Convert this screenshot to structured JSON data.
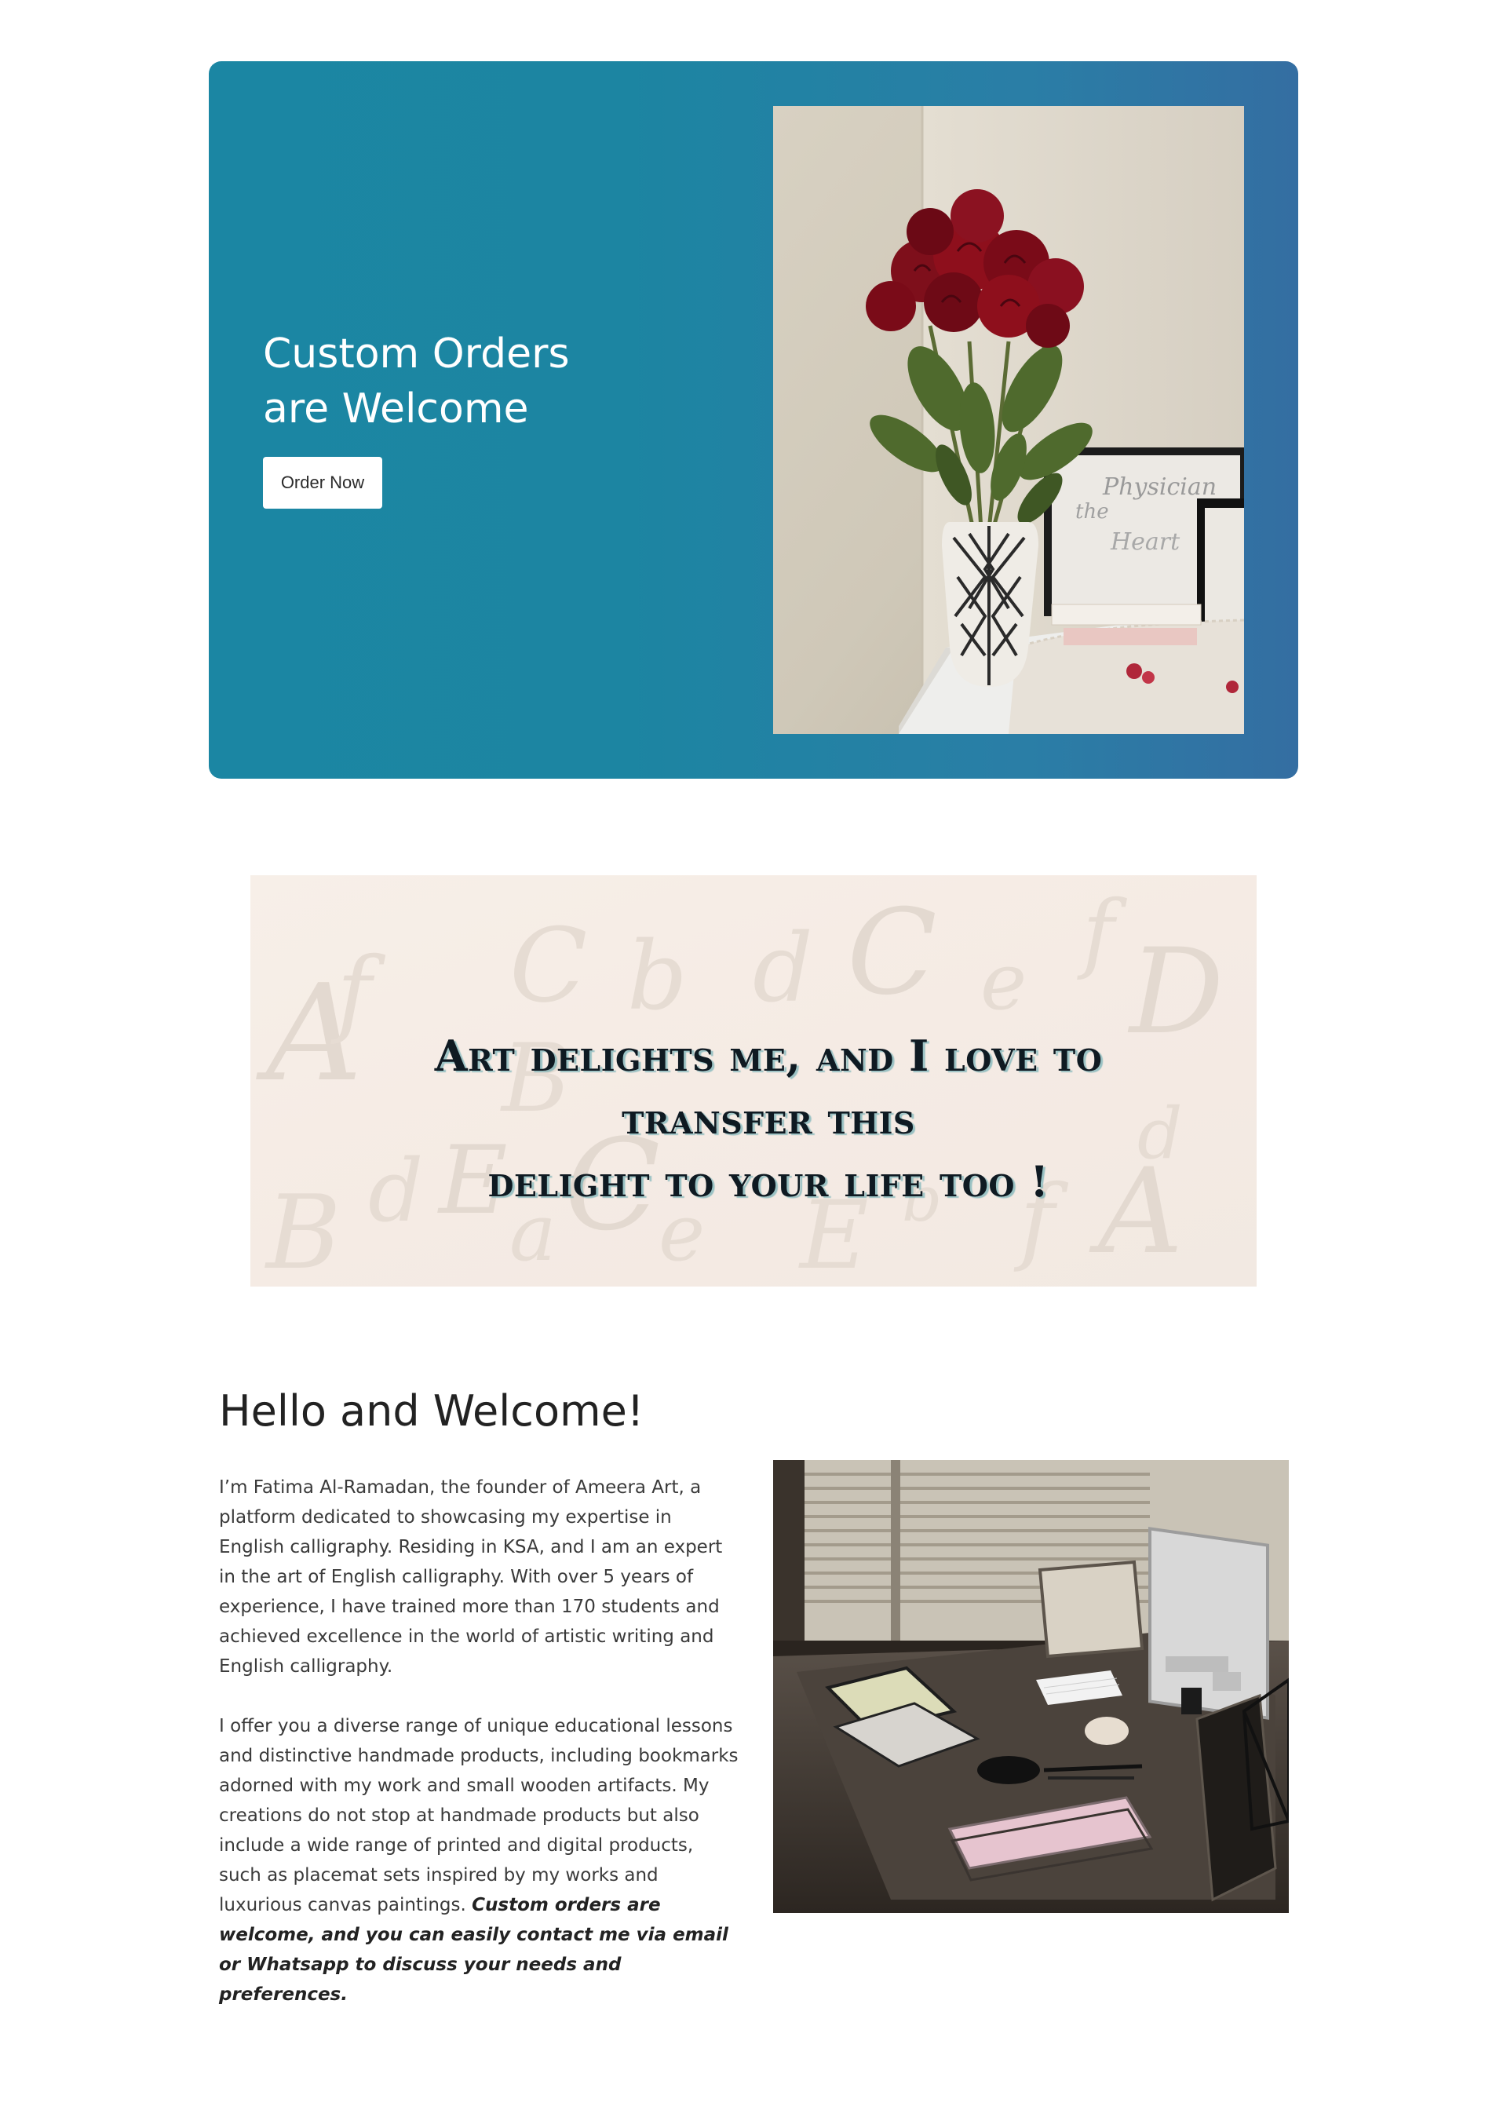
{
  "hero": {
    "title_line1": "Custom Orders",
    "title_line2": "are Welcome",
    "button_label": "Order Now",
    "photo_caption_text": "Physician of the Heart"
  },
  "banner": {
    "quote_line1": "Art delights me, and I love to transfer this",
    "quote_line2": "delight to your life too !"
  },
  "about": {
    "title": "Hello and Welcome!",
    "paragraph1": "I’m Fatima Al-Ramadan, the founder of Ameera Art, a platform dedicated to showcasing my expertise in English calligraphy. Residing in KSA, and I am an expert in the art of English calligraphy. With over 5 years of experience, I have trained more than 170 students and achieved excellence in the world of artistic writing and English calligraphy.",
    "paragraph2": "I offer you a diverse range of unique educational lessons and distinctive handmade products, including bookmarks adorned with my work and small wooden artifacts. My creations do not stop at handmade products but also include a wide range of printed and digital products, such as placemat sets inspired by my works and luxurious canvas paintings.",
    "paragraph2_emphasis": "Custom orders are welcome, and you can easily contact me via email or Whatsapp to discuss your needs and preferences."
  },
  "colors": {
    "hero_gradient_start": "#1b86a3",
    "hero_gradient_end": "#346ea2",
    "rose": "#8e0f1c",
    "banner_paper": "#f6ede6"
  }
}
